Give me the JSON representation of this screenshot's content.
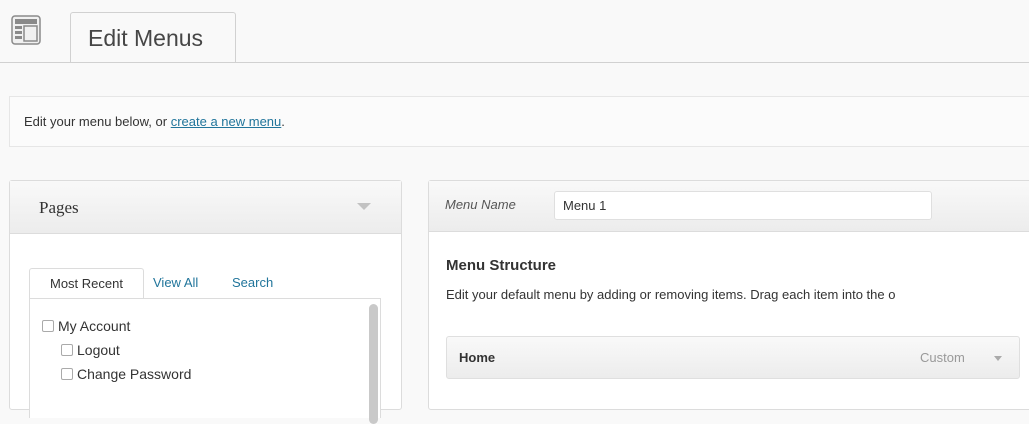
{
  "header": {
    "icon": "menus-screen-icon",
    "title": "Edit Menus"
  },
  "notice": {
    "text": "Edit your menu below, or ",
    "link_text": "create a new menu",
    "suffix": "."
  },
  "pages_box": {
    "title": "Pages",
    "tabs": [
      "Most Recent",
      "View All",
      "Search"
    ],
    "items": [
      {
        "label": "My Account",
        "level": 0
      },
      {
        "label": "Logout",
        "level": 1
      },
      {
        "label": "Change Password",
        "level": 1
      }
    ]
  },
  "menu_box": {
    "menu_name_label": "Menu Name",
    "menu_name_value": "Menu 1",
    "structure_title": "Menu Structure",
    "structure_desc": "Edit your default menu by adding or removing items. Drag each item into the o",
    "items": [
      {
        "title": "Home",
        "type": "Custom"
      }
    ]
  },
  "colors": {
    "link": "#21759b",
    "border": "#dcdcdc"
  }
}
